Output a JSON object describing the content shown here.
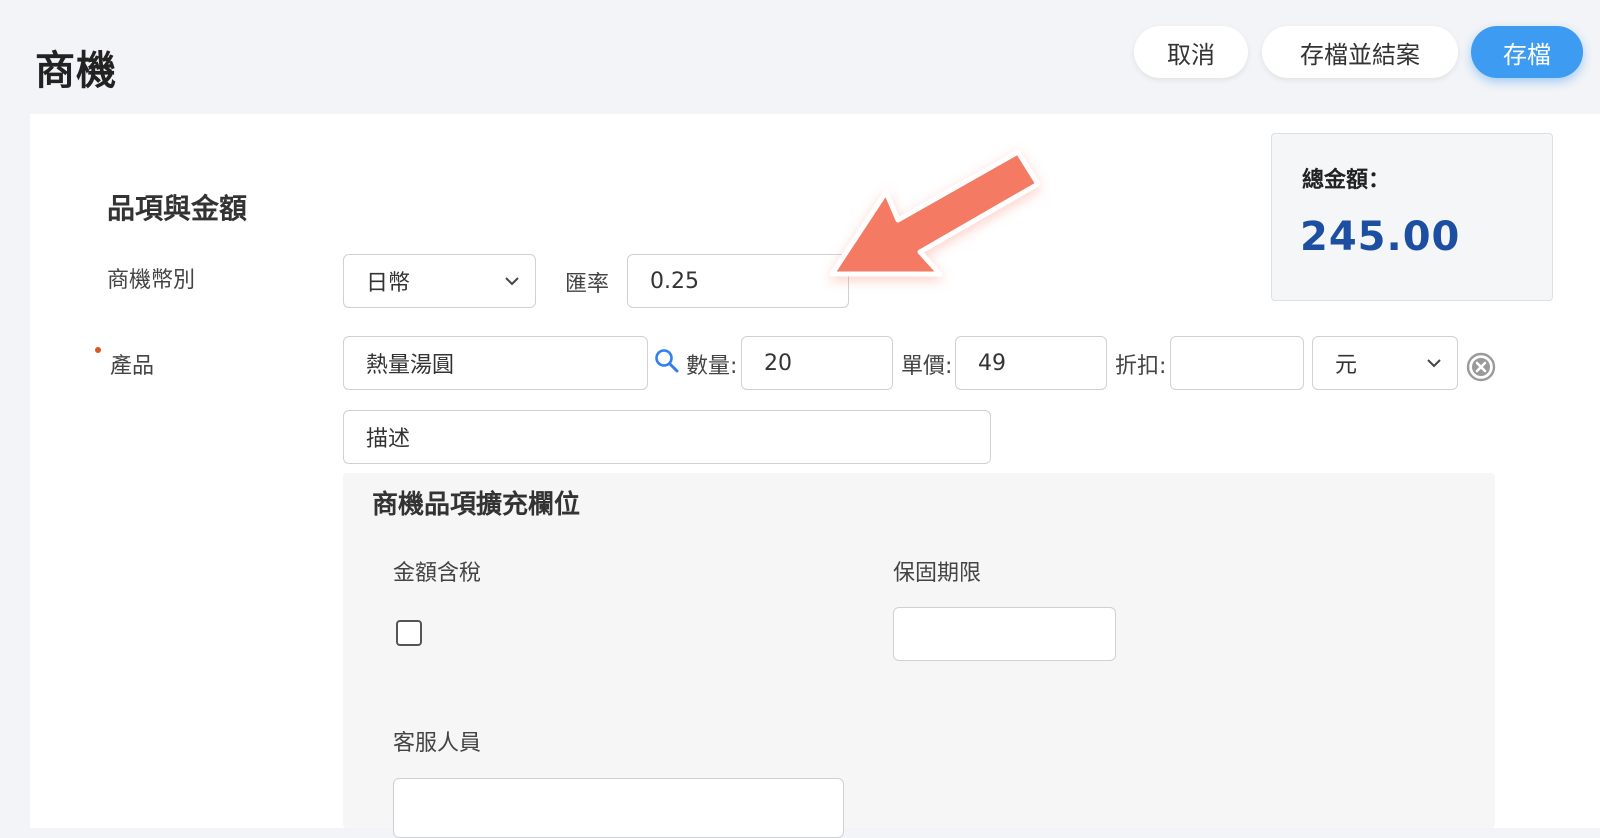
{
  "header": {
    "title": "商機",
    "cancel_label": "取消",
    "save_close_label": "存檔並結案",
    "save_label": "存檔"
  },
  "total": {
    "label": "總金額：",
    "value": "245.00"
  },
  "section": {
    "title": "品項與金額"
  },
  "currency": {
    "label": "商機幣別",
    "selected": "日幣",
    "exchange_rate_label": "匯率",
    "exchange_rate_value": "0.25"
  },
  "product": {
    "label": "產品",
    "name_value": "熱量湯圓",
    "quantity_label": "數量:",
    "quantity_value": "20",
    "unit_price_label": "單價:",
    "unit_price_value": "49",
    "discount_label": "折扣:",
    "discount_value": "",
    "discount_unit_selected": "元",
    "description_placeholder": "描述"
  },
  "extension": {
    "title": "商機品項擴充欄位",
    "tax_included_label": "金額含稅",
    "warranty_label": "保固期限",
    "warranty_value": "",
    "service_staff_label": "客服人員",
    "service_staff_value": ""
  },
  "colors": {
    "primary": "#3d9bf2",
    "total_value": "#1c4ea2",
    "required_dot": "#e2541d",
    "annotation_arrow": "#f47a64"
  },
  "icons": {
    "search": "search-icon",
    "remove": "close-circle-icon",
    "dropdown": "chevron-down-icon",
    "annotation": "arrow-annotation-icon"
  }
}
